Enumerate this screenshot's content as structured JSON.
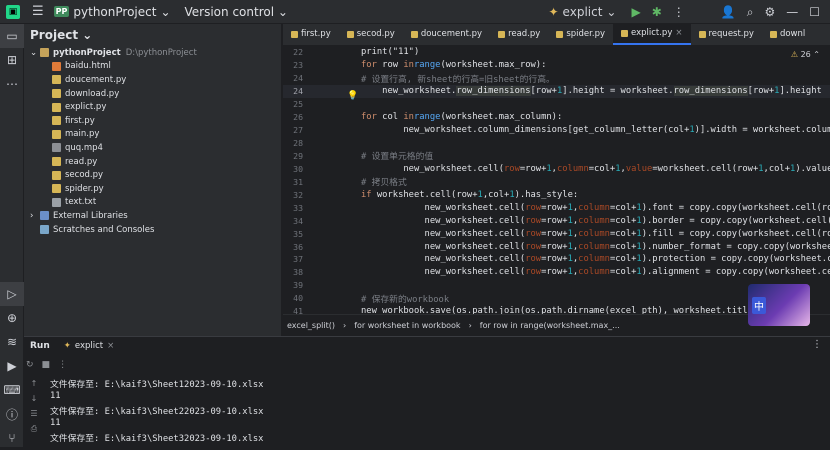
{
  "titlebar": {
    "project_name": "pythonProject",
    "project_badge": "PP",
    "vcs_label": "Version control",
    "run_config": "explict"
  },
  "project_panel": {
    "title": "Project",
    "root": {
      "name": "pythonProject",
      "path": "D:\\pythonProject"
    },
    "files": [
      "baidu.html",
      "doucement.py",
      "download.py",
      "explict.py",
      "first.py",
      "main.py",
      "quq.mp4",
      "read.py",
      "secod.py",
      "spider.py",
      "text.txt"
    ],
    "external_libraries": "External Libraries",
    "scratches": "Scratches and Consoles"
  },
  "editor": {
    "tabs": [
      "first.py",
      "secod.py",
      "doucement.py",
      "read.py",
      "spider.py",
      "explict.py",
      "request.py",
      "downl"
    ],
    "active_tab": "explict.py",
    "warnings_count": "26",
    "breadcrumbs": [
      "excel_split()",
      "for worksheet in workbook",
      "for row in range(worksheet.max_..."
    ]
  },
  "run_panel": {
    "title": "Run",
    "tab": "explict",
    "output": [
      "文件保存至: E:\\kaif3\\Sheet12023-09-10.xlsx",
      "11",
      "文件保存至: E:\\kaif3\\Sheet22023-09-10.xlsx",
      "11",
      "文件保存至: E:\\kaif3\\Sheet32023-09-10.xlsx"
    ]
  },
  "badge_text": "中"
}
